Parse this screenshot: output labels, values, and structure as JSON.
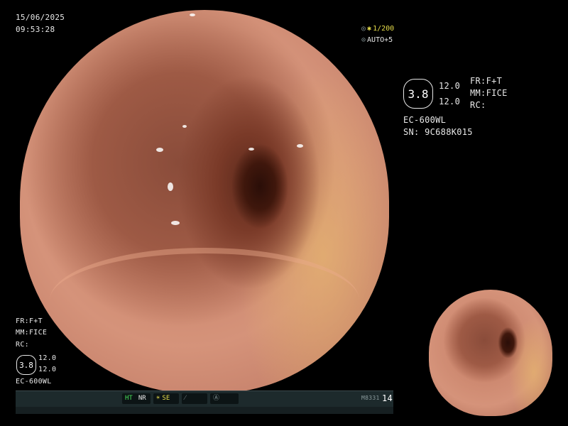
{
  "header": {
    "date": "15/06/2025",
    "time": "09:53:28"
  },
  "top_right_indicators": {
    "shutter_icon": "aperture-icon",
    "shutter": "1/200",
    "iris_icon": "iris-icon",
    "iris": "AUTO+5"
  },
  "info_panel": {
    "zoom_badge": "3.8",
    "value_top": "12.0",
    "value_bottom": "12.0",
    "fr": "FR:F+T",
    "mm": "MM:FICE",
    "rc": "RC:",
    "scope_model": "EC-600WL",
    "serial": "SN: 9C688K015"
  },
  "lower_left_panel": {
    "fr": "FR:F+T",
    "mm": "MM:FICE",
    "rc": "RC:",
    "zoom_badge": "3.8",
    "value_top": "12.0",
    "value_bottom": "12.0",
    "scope_model": "EC-600WL"
  },
  "status_bar": {
    "ht": "HT",
    "nr": "NR",
    "se_icon": "sun-icon",
    "se": "SE",
    "slash_icon": "slash-icon",
    "a_icon": "circle-a-icon",
    "code": "M8331",
    "count": "14"
  },
  "colors": {
    "green_indicator": "#48e05a",
    "yellow_indicator": "#e8de4a",
    "text": "#e8e8e8",
    "background": "#000000"
  }
}
